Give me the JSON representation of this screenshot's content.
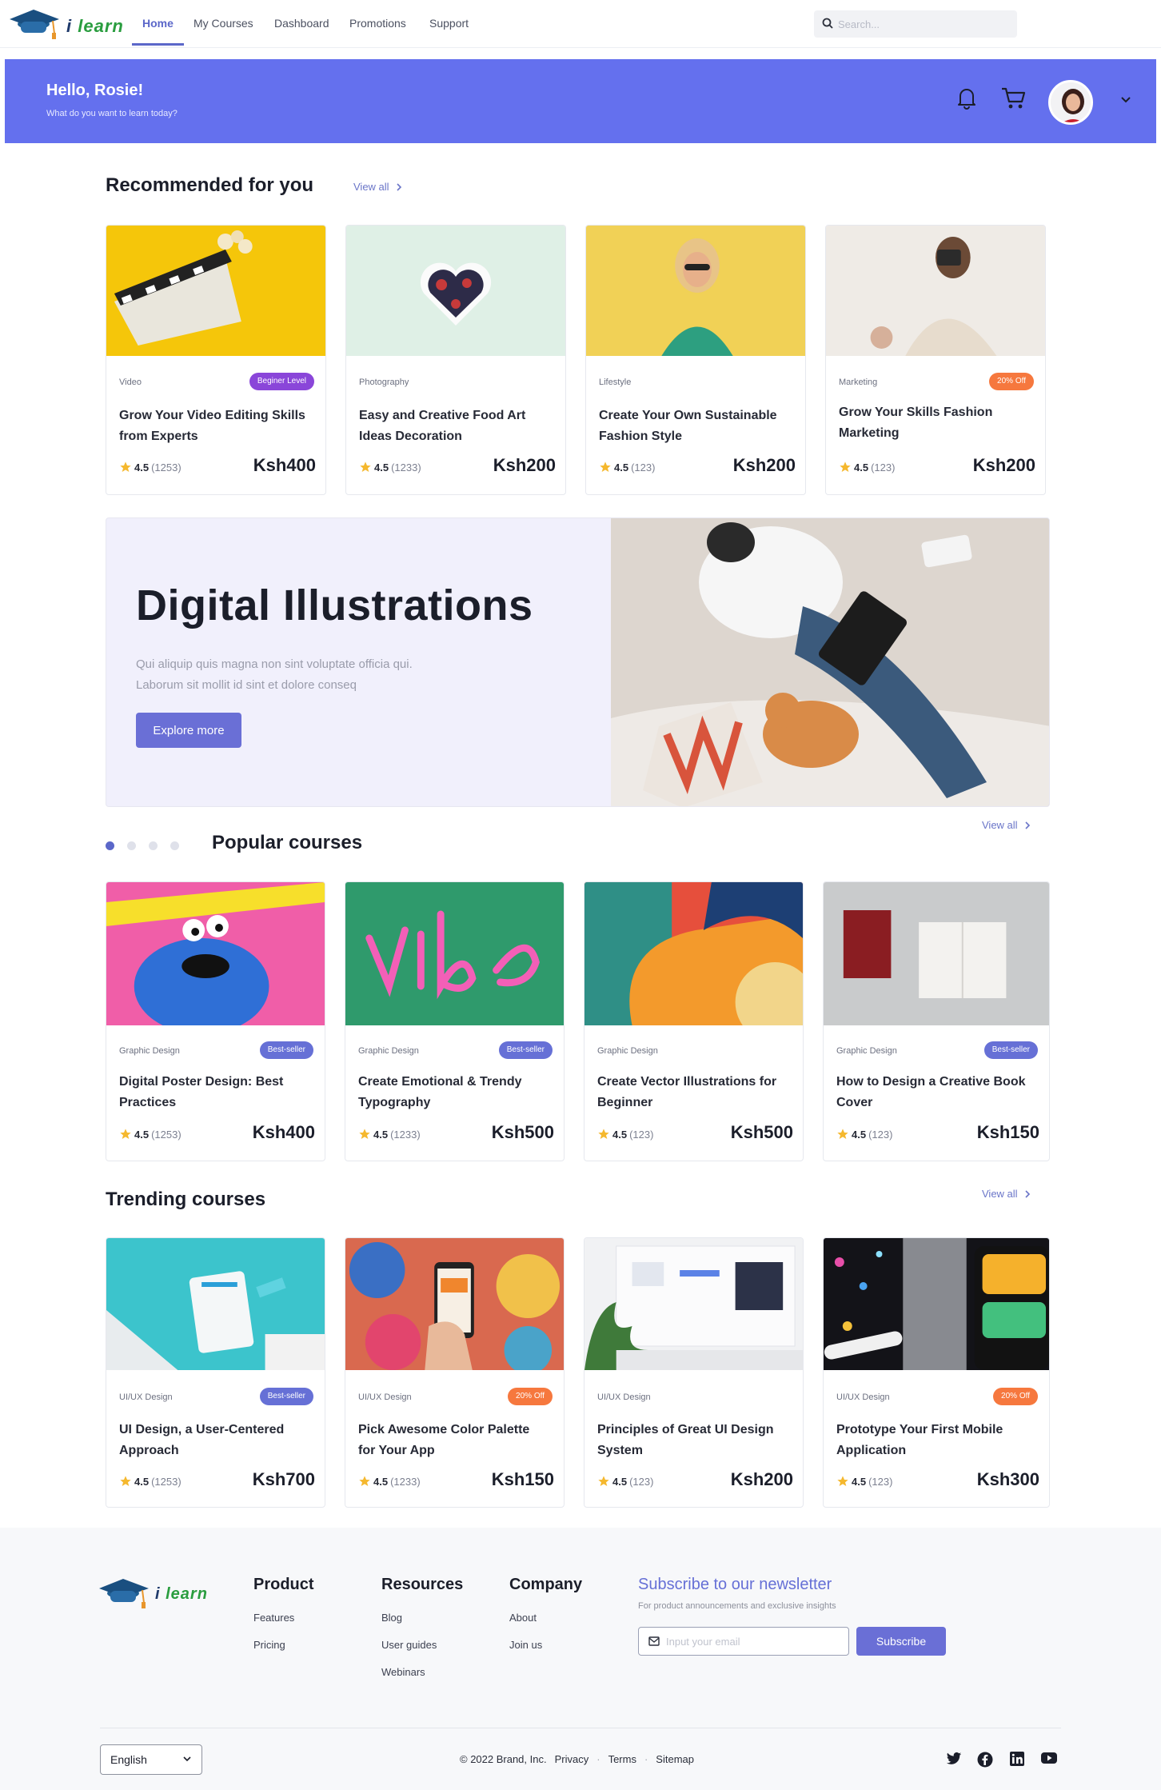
{
  "brand": {
    "name": "learn",
    "prefix": "i"
  },
  "nav": {
    "links": [
      "Home",
      "My Courses",
      "Dashboard",
      "Promotions",
      "Support"
    ],
    "search_placeholder": "Search..."
  },
  "hero": {
    "greeting": "Hello, Rosie!",
    "subtitle": "What do you want to learn today?"
  },
  "recommended": {
    "title": "Recommended for you",
    "view_all": "View all",
    "cards": [
      {
        "category": "Video",
        "badge": "Beginer Level",
        "title": "Grow Your Video Editing Skills from Experts",
        "rating": "4.5",
        "count": "(1253)",
        "price": "Ksh400"
      },
      {
        "category": "Photography",
        "badge": "",
        "title": "Easy and Creative Food Art Ideas Decoration",
        "rating": "4.5",
        "count": "(1233)",
        "price": "Ksh200"
      },
      {
        "category": "Lifestyle",
        "badge": "",
        "title": "Create Your Own Sustainable Fashion Style",
        "rating": "4.5",
        "count": "(123)",
        "price": "Ksh200"
      },
      {
        "category": "Marketing",
        "badge": "20% Off",
        "title": "Grow Your Skills Fashion Marketing",
        "rating": "4.5",
        "count": "(123)",
        "price": "Ksh200"
      }
    ]
  },
  "feature": {
    "title": "Digital Illustrations",
    "desc_line1": "Qui aliquip quis magna non sint voluptate officia qui.",
    "desc_line2": "Laborum sit mollit id sint et dolore conseq",
    "button": "Explore more"
  },
  "popular": {
    "title": "Popular courses",
    "view_all": "View all",
    "cards": [
      {
        "category": "Graphic Design",
        "badge": "Best-seller",
        "title": "Digital Poster Design: Best Practices",
        "rating": "4.5",
        "count": "(1253)",
        "price": "Ksh400"
      },
      {
        "category": "Graphic Design",
        "badge": "Best-seller",
        "title": "Create Emotional & Trendy Typography",
        "rating": "4.5",
        "count": "(1233)",
        "price": "Ksh500"
      },
      {
        "category": "Graphic Design",
        "badge": "",
        "title": "Create Vector Illustrations for Beginner",
        "rating": "4.5",
        "count": "(123)",
        "price": "Ksh500"
      },
      {
        "category": "Graphic Design",
        "badge": "Best-seller",
        "title": "How to Design a Creative Book Cover",
        "rating": "4.5",
        "count": "(123)",
        "price": "Ksh150"
      }
    ]
  },
  "trending": {
    "title": "Trending courses",
    "view_all": "View all",
    "cards": [
      {
        "category": "UI/UX Design",
        "badge": "Best-seller",
        "title": "UI Design, a User-Centered Approach",
        "rating": "4.5",
        "count": "(1253)",
        "price": "Ksh700"
      },
      {
        "category": "UI/UX Design",
        "badge": "20% Off",
        "title": "Pick Awesome Color Palette for Your App",
        "rating": "4.5",
        "count": "(1233)",
        "price": "Ksh150"
      },
      {
        "category": "UI/UX Design",
        "badge": "",
        "title": "Principles of Great UI Design System",
        "rating": "4.5",
        "count": "(123)",
        "price": "Ksh200"
      },
      {
        "category": "UI/UX Design",
        "badge": "20% Off",
        "title": "Prototype Your First Mobile Application",
        "rating": "4.5",
        "count": "(123)",
        "price": "Ksh300"
      }
    ]
  },
  "footer": {
    "product": {
      "title": "Product",
      "links": [
        "Features",
        "Pricing"
      ]
    },
    "resources": {
      "title": "Resources",
      "links": [
        "Blog",
        "User guides",
        "Webinars"
      ]
    },
    "company": {
      "title": "Company",
      "links": [
        "About",
        "Join us"
      ]
    },
    "newsletter": {
      "title": "Subscribe to our newsletter",
      "subtitle": "For product announcements and exclusive insights",
      "placeholder": "Input your email",
      "button": "Subscribe"
    },
    "language": "English",
    "copyright": "© 2022 Brand, Inc.",
    "legal_links": [
      "Privacy",
      "Terms",
      "Sitemap"
    ]
  },
  "colors": {
    "accent": "#6470ee",
    "button": "#6a6fd6",
    "badge_purple": "#8a46d9",
    "badge_blue": "#6670d6",
    "badge_orange": "#f6783e",
    "star": "#f5b82e"
  },
  "icons": [
    "search-icon",
    "bell-icon",
    "cart-icon",
    "chevron-down-icon",
    "chevron-right-icon",
    "star-icon",
    "mail-icon",
    "twitter-icon",
    "facebook-icon",
    "linkedin-icon",
    "youtube-icon"
  ]
}
